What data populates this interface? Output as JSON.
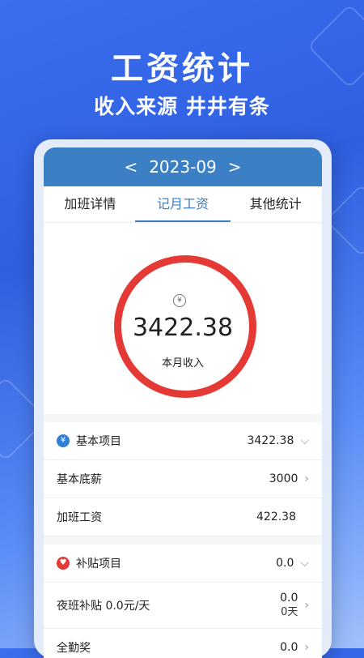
{
  "hero": {
    "title": "工资统计",
    "subtitle": "收入来源 井井有条"
  },
  "month": {
    "prev": "<",
    "value": "2023-09",
    "next": ">"
  },
  "tabs": [
    "加班详情",
    "记月工资",
    "其他统计"
  ],
  "summary": {
    "currency_icon": "¥",
    "amount": "3422.38",
    "label": "本月收入"
  },
  "basic": {
    "header": {
      "label": "基本项目",
      "value": "3422.38",
      "icon": "yen-icon"
    },
    "rows": [
      {
        "label": "基本底薪",
        "value": "3000"
      },
      {
        "label": "加班工资",
        "value": "422.38"
      }
    ]
  },
  "allowance": {
    "header": {
      "label": "补贴项目",
      "value": "0.0",
      "icon": "heart-icon"
    },
    "rows": [
      {
        "label": "夜班补贴 0.0元/天",
        "value": "0.0",
        "sub": "0天"
      },
      {
        "label": "全勤奖",
        "value": "0.0"
      }
    ]
  },
  "colors": {
    "accent": "#3b7fc4",
    "ring": "#e53935"
  }
}
